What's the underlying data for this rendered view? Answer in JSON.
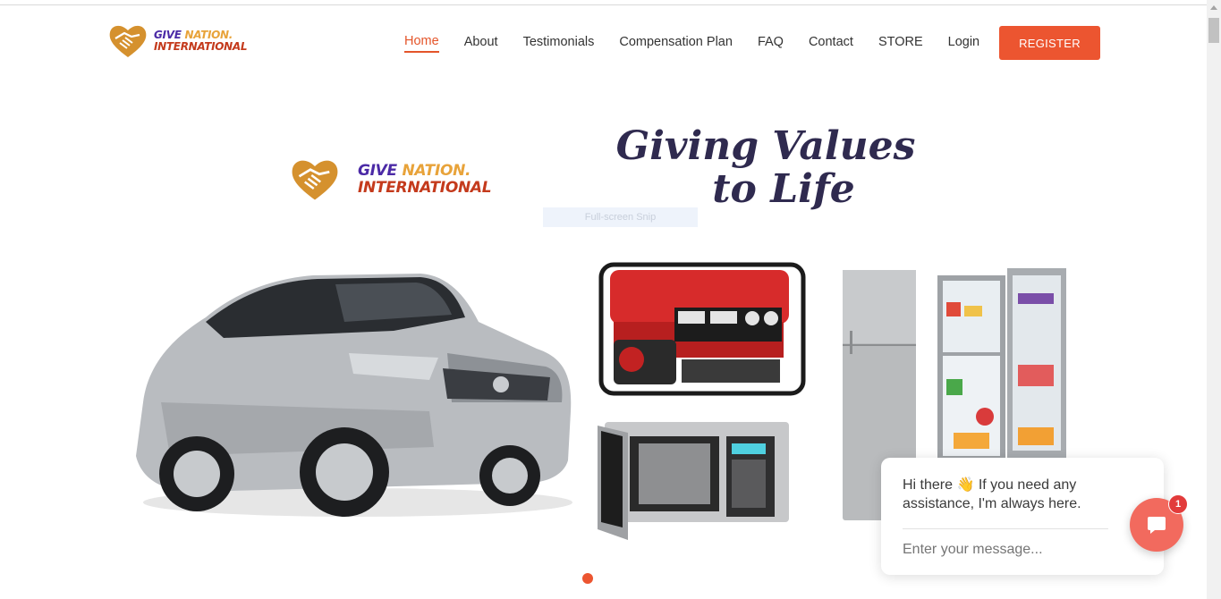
{
  "brand": {
    "give": "GIVE",
    "nation": "NATION.",
    "international": "INTERNATIONAL",
    "icon": "handshake-heart-icon",
    "colors": {
      "purple": "#4b2aa6",
      "gold": "#e8a33a",
      "red": "#c43a1c",
      "accent": "#ec5530"
    }
  },
  "nav": {
    "items": [
      {
        "label": "Home",
        "active": true
      },
      {
        "label": "About"
      },
      {
        "label": "Testimonials"
      },
      {
        "label": "Compensation Plan"
      },
      {
        "label": "FAQ"
      },
      {
        "label": "Contact"
      },
      {
        "label": "STORE"
      },
      {
        "label": "Login"
      }
    ],
    "register_label": "REGISTER"
  },
  "hero": {
    "tagline_line1": "Giving Values",
    "tagline_line2": "to Life",
    "overlay_text": "Full-screen Snip",
    "images": [
      "suv-car-image",
      "generator-image",
      "microwave-image",
      "refrigerator-closed-image",
      "refrigerator-open-image"
    ]
  },
  "chat": {
    "message": "Hi there 👋 If you need any assistance, I'm always here.",
    "input_placeholder": "Enter your message...",
    "badge_count": "1",
    "button_icon": "chat-bubble-icon"
  }
}
